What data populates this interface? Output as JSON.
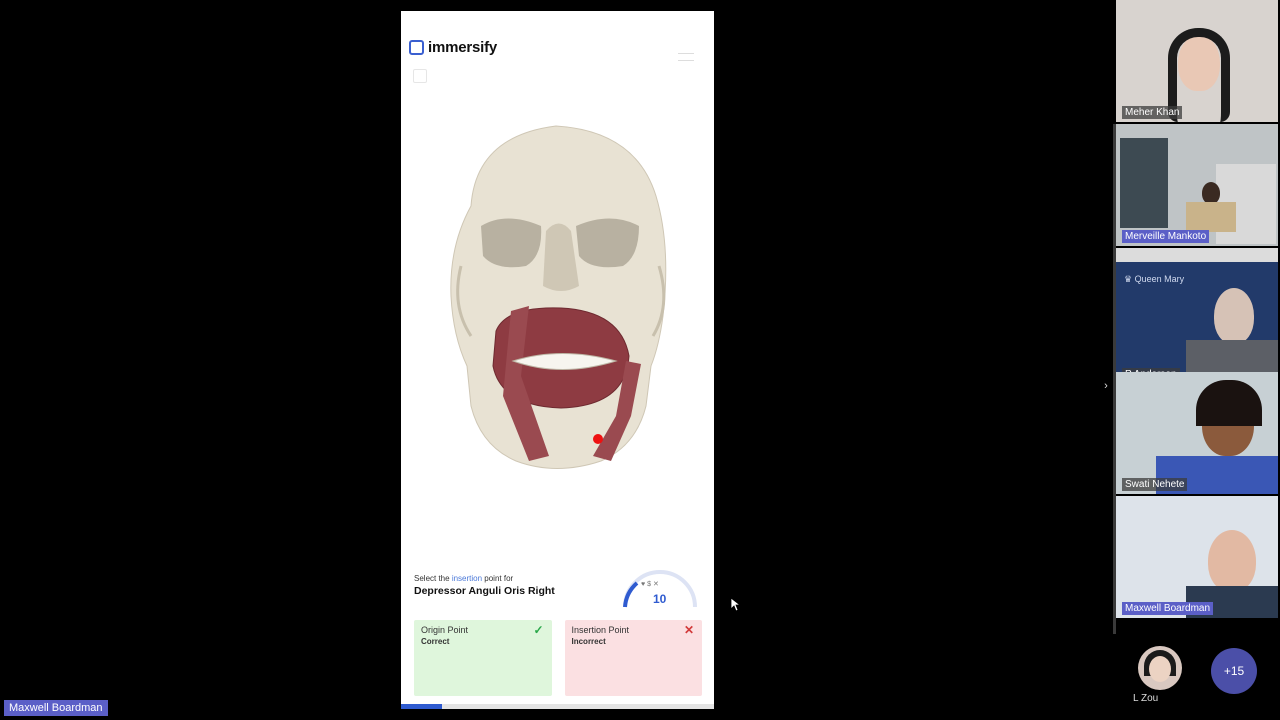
{
  "app": {
    "brand": "immersify",
    "prompt_prefix": "Select the ",
    "prompt_highlight": "insertion",
    "prompt_suffix": " point for",
    "muscle_name": "Depressor Anguli Oris Right",
    "timer_value": "10",
    "timer_icons": "♥ $ ✕",
    "cards": [
      {
        "title": "Origin Point",
        "status": "Correct",
        "icon": "check-icon"
      },
      {
        "title": "Insertion Point",
        "status": "Incorrect",
        "icon": "close-icon"
      }
    ],
    "progress_fraction": 0.13
  },
  "participants": [
    {
      "name": "Meher Khan"
    },
    {
      "name": "Merveille Mankoto"
    },
    {
      "name": "P Anderson"
    },
    {
      "name": "Swati Nehete"
    },
    {
      "name": "Maxwell Boardman"
    }
  ],
  "bottom_participant": "L Zou",
  "more_count": "+15",
  "presenter_label": "Maxwell Boardman",
  "colors": {
    "accent": "#5b5fc7",
    "app_blue": "#2f5bd0",
    "correct": "#2aa84a",
    "incorrect": "#d23a3a"
  }
}
